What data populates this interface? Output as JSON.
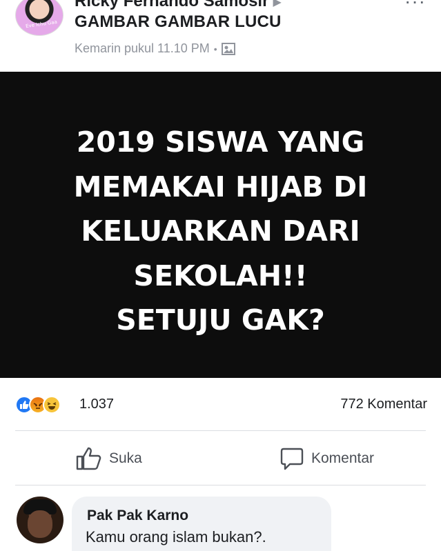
{
  "post": {
    "author": "Ricky Fernando Samosir",
    "group": "GAMBAR GAMBAR LUCU",
    "timestamp": "Kemarin pukul 11.10 PM",
    "meta_separator": "•",
    "avatar_caption": "Eve Ichu Gaa",
    "image_text_lines": [
      "2019 SISWA YANG",
      "MEMAKAI HIJAB DI",
      "KELUARKAN DARI",
      "SEKOLAH!!",
      "SETUJU GAK?"
    ]
  },
  "reactions": {
    "icons": [
      "like-icon",
      "angry-icon",
      "haha-icon"
    ],
    "count": "1.037",
    "comments": "772 Komentar"
  },
  "actions": {
    "like_label": "Suka",
    "comment_label": "Komentar"
  },
  "comment": {
    "author": "Pak Pak Karno",
    "text": "Kamu orang islam bukan?."
  },
  "colors": {
    "like_blue": "#2078f4",
    "image_bg": "#0d0d0d",
    "muted": "#90949c"
  }
}
